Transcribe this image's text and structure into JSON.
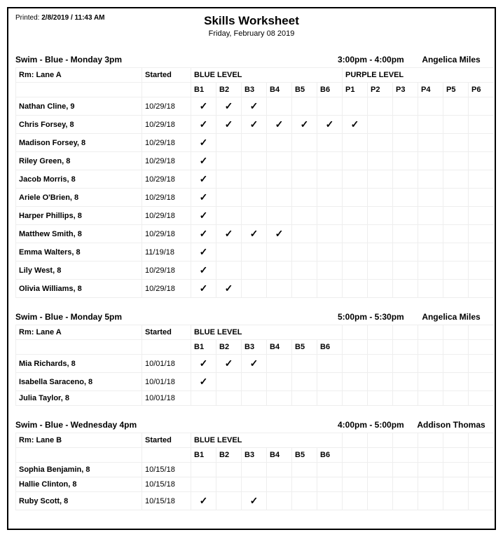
{
  "printed_label": "Printed:",
  "printed_value": "2/8/2019 / 11:43 AM",
  "title": "Skills Worksheet",
  "subtitle": "Friday, February 08 2019",
  "room_prefix": "Rm:",
  "started_header": "Started",
  "sessions": [
    {
      "name": "Swim - Blue - Monday 3pm",
      "time": "3:00pm - 4:00pm",
      "instructor": "Angelica Miles",
      "room": "Lane A",
      "levels": [
        {
          "label": "BLUE LEVEL",
          "cols": [
            "B1",
            "B2",
            "B3",
            "B4",
            "B5",
            "B6"
          ]
        },
        {
          "label": "PURPLE LEVEL",
          "cols": [
            "P1",
            "P2",
            "P3",
            "P4",
            "P5",
            "P6"
          ]
        }
      ],
      "students": [
        {
          "name": "Nathan Cline, 9",
          "started": "10/29/18",
          "skills": [
            true,
            true,
            true,
            false,
            false,
            false,
            false,
            false,
            false,
            false,
            false,
            false
          ]
        },
        {
          "name": "Chris Forsey, 8",
          "started": "10/29/18",
          "skills": [
            true,
            true,
            true,
            true,
            true,
            true,
            true,
            false,
            false,
            false,
            false,
            false
          ]
        },
        {
          "name": "Madison Forsey, 8",
          "started": "10/29/18",
          "skills": [
            true,
            false,
            false,
            false,
            false,
            false,
            false,
            false,
            false,
            false,
            false,
            false
          ]
        },
        {
          "name": "Riley Green, 8",
          "started": "10/29/18",
          "skills": [
            true,
            false,
            false,
            false,
            false,
            false,
            false,
            false,
            false,
            false,
            false,
            false
          ]
        },
        {
          "name": "Jacob Morris, 8",
          "started": "10/29/18",
          "skills": [
            true,
            false,
            false,
            false,
            false,
            false,
            false,
            false,
            false,
            false,
            false,
            false
          ]
        },
        {
          "name": "Ariele O'Brien, 8",
          "started": "10/29/18",
          "skills": [
            true,
            false,
            false,
            false,
            false,
            false,
            false,
            false,
            false,
            false,
            false,
            false
          ]
        },
        {
          "name": "Harper Phillips, 8",
          "started": "10/29/18",
          "skills": [
            true,
            false,
            false,
            false,
            false,
            false,
            false,
            false,
            false,
            false,
            false,
            false
          ]
        },
        {
          "name": "Matthew Smith, 8",
          "started": "10/29/18",
          "skills": [
            true,
            true,
            true,
            true,
            false,
            false,
            false,
            false,
            false,
            false,
            false,
            false
          ]
        },
        {
          "name": "Emma Walters, 8",
          "started": "11/19/18",
          "skills": [
            true,
            false,
            false,
            false,
            false,
            false,
            false,
            false,
            false,
            false,
            false,
            false
          ]
        },
        {
          "name": "Lily West, 8",
          "started": "10/29/18",
          "skills": [
            true,
            false,
            false,
            false,
            false,
            false,
            false,
            false,
            false,
            false,
            false,
            false
          ]
        },
        {
          "name": "Olivia Williams, 8",
          "started": "10/29/18",
          "skills": [
            true,
            true,
            false,
            false,
            false,
            false,
            false,
            false,
            false,
            false,
            false,
            false
          ]
        }
      ]
    },
    {
      "name": "Swim - Blue - Monday 5pm",
      "time": "5:00pm - 5:30pm",
      "instructor": "Angelica Miles",
      "room": "Lane A",
      "levels": [
        {
          "label": "BLUE LEVEL",
          "cols": [
            "B1",
            "B2",
            "B3",
            "B4",
            "B5",
            "B6"
          ]
        }
      ],
      "students": [
        {
          "name": "Mia Richards, 8",
          "started": "10/01/18",
          "skills": [
            true,
            true,
            true,
            false,
            false,
            false
          ]
        },
        {
          "name": "Isabella Saraceno, 8",
          "started": "10/01/18",
          "skills": [
            true,
            false,
            false,
            false,
            false,
            false
          ]
        },
        {
          "name": "Julia Taylor, 8",
          "started": "10/01/18",
          "skills": [
            false,
            false,
            false,
            false,
            false,
            false
          ]
        }
      ]
    },
    {
      "name": "Swim - Blue - Wednesday 4pm",
      "time": "4:00pm - 5:00pm",
      "instructor": "Addison Thomas",
      "room": "Lane B",
      "levels": [
        {
          "label": "BLUE LEVEL",
          "cols": [
            "B1",
            "B2",
            "B3",
            "B4",
            "B5",
            "B6"
          ]
        }
      ],
      "students": [
        {
          "name": "Sophia Benjamin, 8",
          "started": "10/15/18",
          "skills": [
            false,
            false,
            false,
            false,
            false,
            false
          ]
        },
        {
          "name": "Hallie Clinton, 8",
          "started": "10/15/18",
          "skills": [
            false,
            false,
            false,
            false,
            false,
            false
          ]
        },
        {
          "name": "Ruby Scott, 8",
          "started": "10/15/18",
          "skills": [
            true,
            false,
            true,
            false,
            false,
            false
          ]
        }
      ]
    }
  ]
}
